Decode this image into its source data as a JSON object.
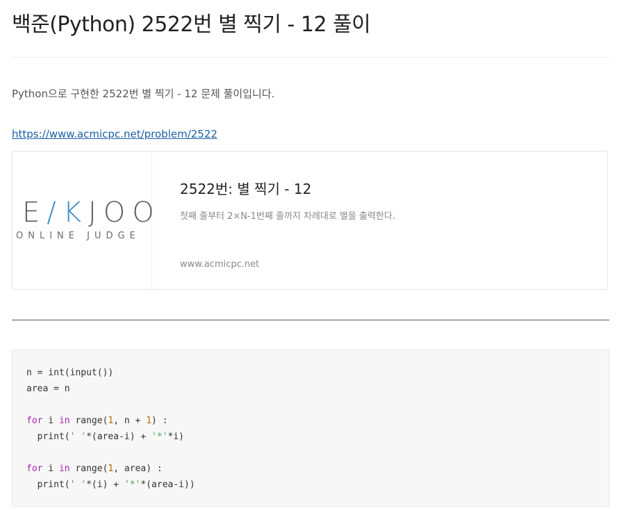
{
  "post": {
    "title": "백준(Python) 2522번 별 찍기 - 12 풀이",
    "intro": "Python으로 구현한 2522번 별 찍기 - 12 문제 풀이입니다.",
    "problem_link": "https://www.acmicpc.net/problem/2522"
  },
  "og_card": {
    "logo_top": "E/KJOO",
    "logo_bottom": "ONLINE JUDGE",
    "title": "2522번: 별 찍기 - 12",
    "description": "첫째 줄부터 2×N-1번째 줄까지 차례대로 별을 출력한다.",
    "domain": "www.acmicpc.net"
  },
  "code": {
    "lines": [
      "n = int(input())",
      "area = n",
      "",
      "for i in range(1, n + 1) :",
      "  print(' '*(area-i) + '*'*i)",
      "",
      "for i in range(1, area) :",
      "  print(' '*(i) + '*'*(area-i))"
    ]
  },
  "colors": {
    "link": "#1b5fa3",
    "keyword": "#a626a4",
    "number": "#b76b01",
    "string": "#50a14f",
    "logo_accent": "#3b8cc6"
  }
}
